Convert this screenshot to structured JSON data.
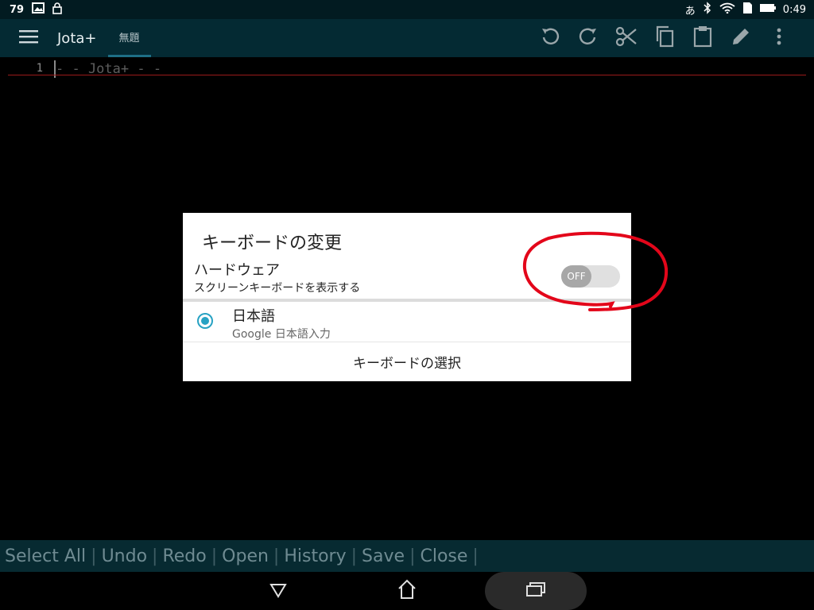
{
  "status_bar": {
    "notification_count": "79",
    "time": "0:49",
    "ime_indicator": "あ",
    "icons": [
      "image-icon",
      "lock-icon",
      "bluetooth-icon",
      "wifi-icon",
      "sd-card-icon",
      "battery-icon"
    ]
  },
  "app_bar": {
    "title": "Jota+",
    "file_tab": "無題",
    "actions": [
      "undo-icon",
      "redo-icon",
      "cut-icon",
      "copy-icon",
      "paste-icon",
      "edit-icon",
      "more-icon"
    ]
  },
  "editor": {
    "line_number": "1",
    "line_text": "- - Jota+ - -"
  },
  "dialog": {
    "title": "キーボードの変更",
    "hardware_label": "ハードウェア",
    "hardware_sub": "スクリーンキーボードを表示する",
    "toggle_state": "OFF",
    "ime_name": "日本語",
    "ime_subtitle": "Google 日本語入力",
    "select_button": "キーボードの選択"
  },
  "function_bar": {
    "buttons": [
      "Select All",
      "Undo",
      "Redo",
      "Open",
      "History",
      "Save",
      "Close"
    ]
  },
  "colors": {
    "accent": "#27a2c3",
    "annotation": "#e3061a",
    "app_bar": "#042a33"
  }
}
